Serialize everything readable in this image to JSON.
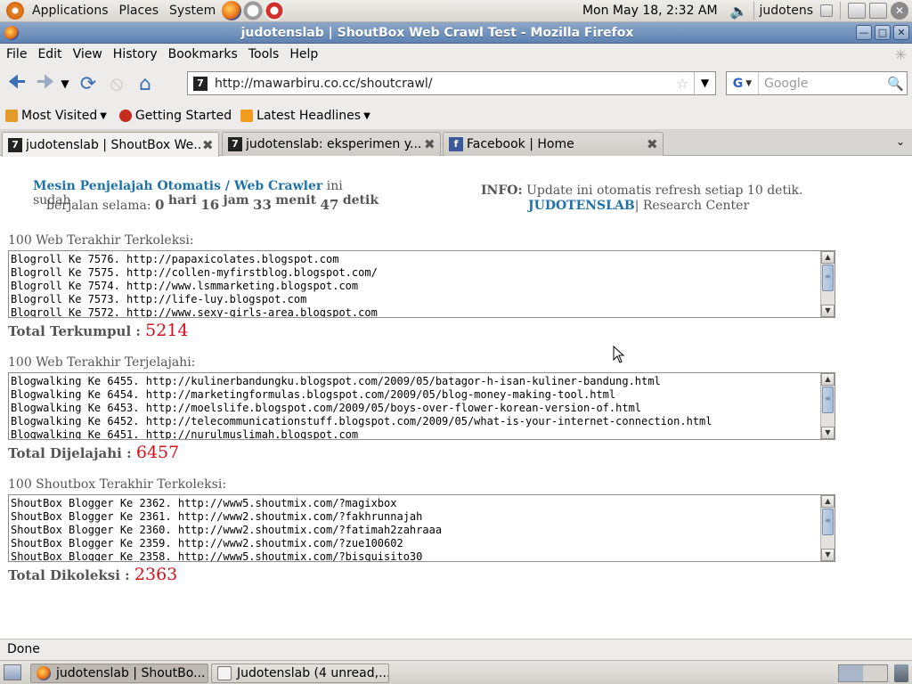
{
  "top_panel": {
    "menus": [
      "Applications",
      "Places",
      "System"
    ],
    "clock": "Mon May 18,  2:32 AM",
    "user": "judotens"
  },
  "window": {
    "title": "judotenslab | ShoutBox Web Crawl Test - Mozilla Firefox"
  },
  "menubar": [
    {
      "label": "File"
    },
    {
      "label": "Edit"
    },
    {
      "label": "View"
    },
    {
      "label": "History"
    },
    {
      "label": "Bookmarks"
    },
    {
      "label": "Tools"
    },
    {
      "label": "Help"
    }
  ],
  "navbar": {
    "url": "http://mawarbiru.co.cc/shoutcrawl/",
    "search_placeholder": "Google",
    "search_engine_letter": "G"
  },
  "bookmarks": [
    {
      "label": "Most Visited",
      "has_menu": true
    },
    {
      "label": "Getting Started",
      "has_menu": false
    },
    {
      "label": "Latest Headlines",
      "has_menu": true
    }
  ],
  "tabs": [
    {
      "label": "judotenslab | ShoutBox We...",
      "active": true
    },
    {
      "label": "judotenslab: eksperimen y...",
      "active": false
    },
    {
      "label": "Facebook | Home",
      "active": false
    }
  ],
  "content": {
    "crawler": {
      "title": "Mesin Penjelajah Otomatis / Web Crawler",
      "suffix": " ini sudah",
      "running_label": "berjalan selama:",
      "days": "0",
      "days_label": "hari",
      "hours": "16",
      "hours_label": "jam",
      "minutes": "33",
      "minutes_label": "menit",
      "seconds": "47",
      "seconds_label": "detik"
    },
    "info": {
      "label": "INFO:",
      "text": "Update ini otomatis refresh setiap 10 detik.",
      "brand": "JUDOTENSLAB",
      "brand_suffix": "| Research Center"
    },
    "sections": [
      {
        "label": "100 Web Terakhir Terkoleksi:",
        "lines": [
          "Blogroll Ke 7576. http://papaxicolates.blogspot.com",
          "Blogroll Ke 7575. http://collen-myfirstblog.blogspot.com/",
          "Blogroll Ke 7574. http://www.lsmmarketing.blogspot.com",
          "Blogroll Ke 7573. http://life-luy.blogspot.com",
          "Blogroll Ke 7572. http://www.sexy-girls-area.blogspot.com"
        ],
        "total_label": "Total Terkumpul :",
        "total_value": "5214"
      },
      {
        "label": "100 Web Terakhir Terjelajahi:",
        "lines": [
          "Blogwalking Ke 6455. http://kulinerbandungku.blogspot.com/2009/05/batagor-h-isan-kuliner-bandung.html",
          "Blogwalking Ke 6454. http://marketingformulas.blogspot.com/2009/05/blog-money-making-tool.html",
          "Blogwalking Ke 6453. http://moelslife.blogspot.com/2009/05/boys-over-flower-korean-version-of.html",
          "Blogwalking Ke 6452. http://telecommunicationstuff.blogspot.com/2009/05/what-is-your-internet-connection.html",
          "Blogwalking Ke 6451. http://nurulmuslimah.blogspot.com"
        ],
        "total_label": "Total Dijelajahi :",
        "total_value": "6457"
      },
      {
        "label": "100 Shoutbox Terakhir Terkoleksi:",
        "lines": [
          "ShoutBox Blogger Ke 2362. http://www5.shoutmix.com/?magixbox",
          "ShoutBox Blogger Ke 2361. http://www2.shoutmix.com/?fakhrunnajah",
          "ShoutBox Blogger Ke 2360. http://www2.shoutmix.com/?fatimah2zahraaa",
          "ShoutBox Blogger Ke 2359. http://www2.shoutmix.com/?zue100602",
          "ShoutBox Blogger Ke 2358. http://www5.shoutmix.com/?bisquisito30"
        ],
        "total_label": "Total Dikoleksi :",
        "total_value": "2363"
      }
    ]
  },
  "statusbar": {
    "text": "Done"
  },
  "taskbar": [
    {
      "label": "judotenslab | ShoutBo...",
      "active": true
    },
    {
      "label": "Judotenslab (4 unread,...",
      "active": false
    }
  ],
  "colors": {
    "link_blue": "#2073a8",
    "total_red": "#d4101a",
    "titlebar": "#5d82b2"
  }
}
